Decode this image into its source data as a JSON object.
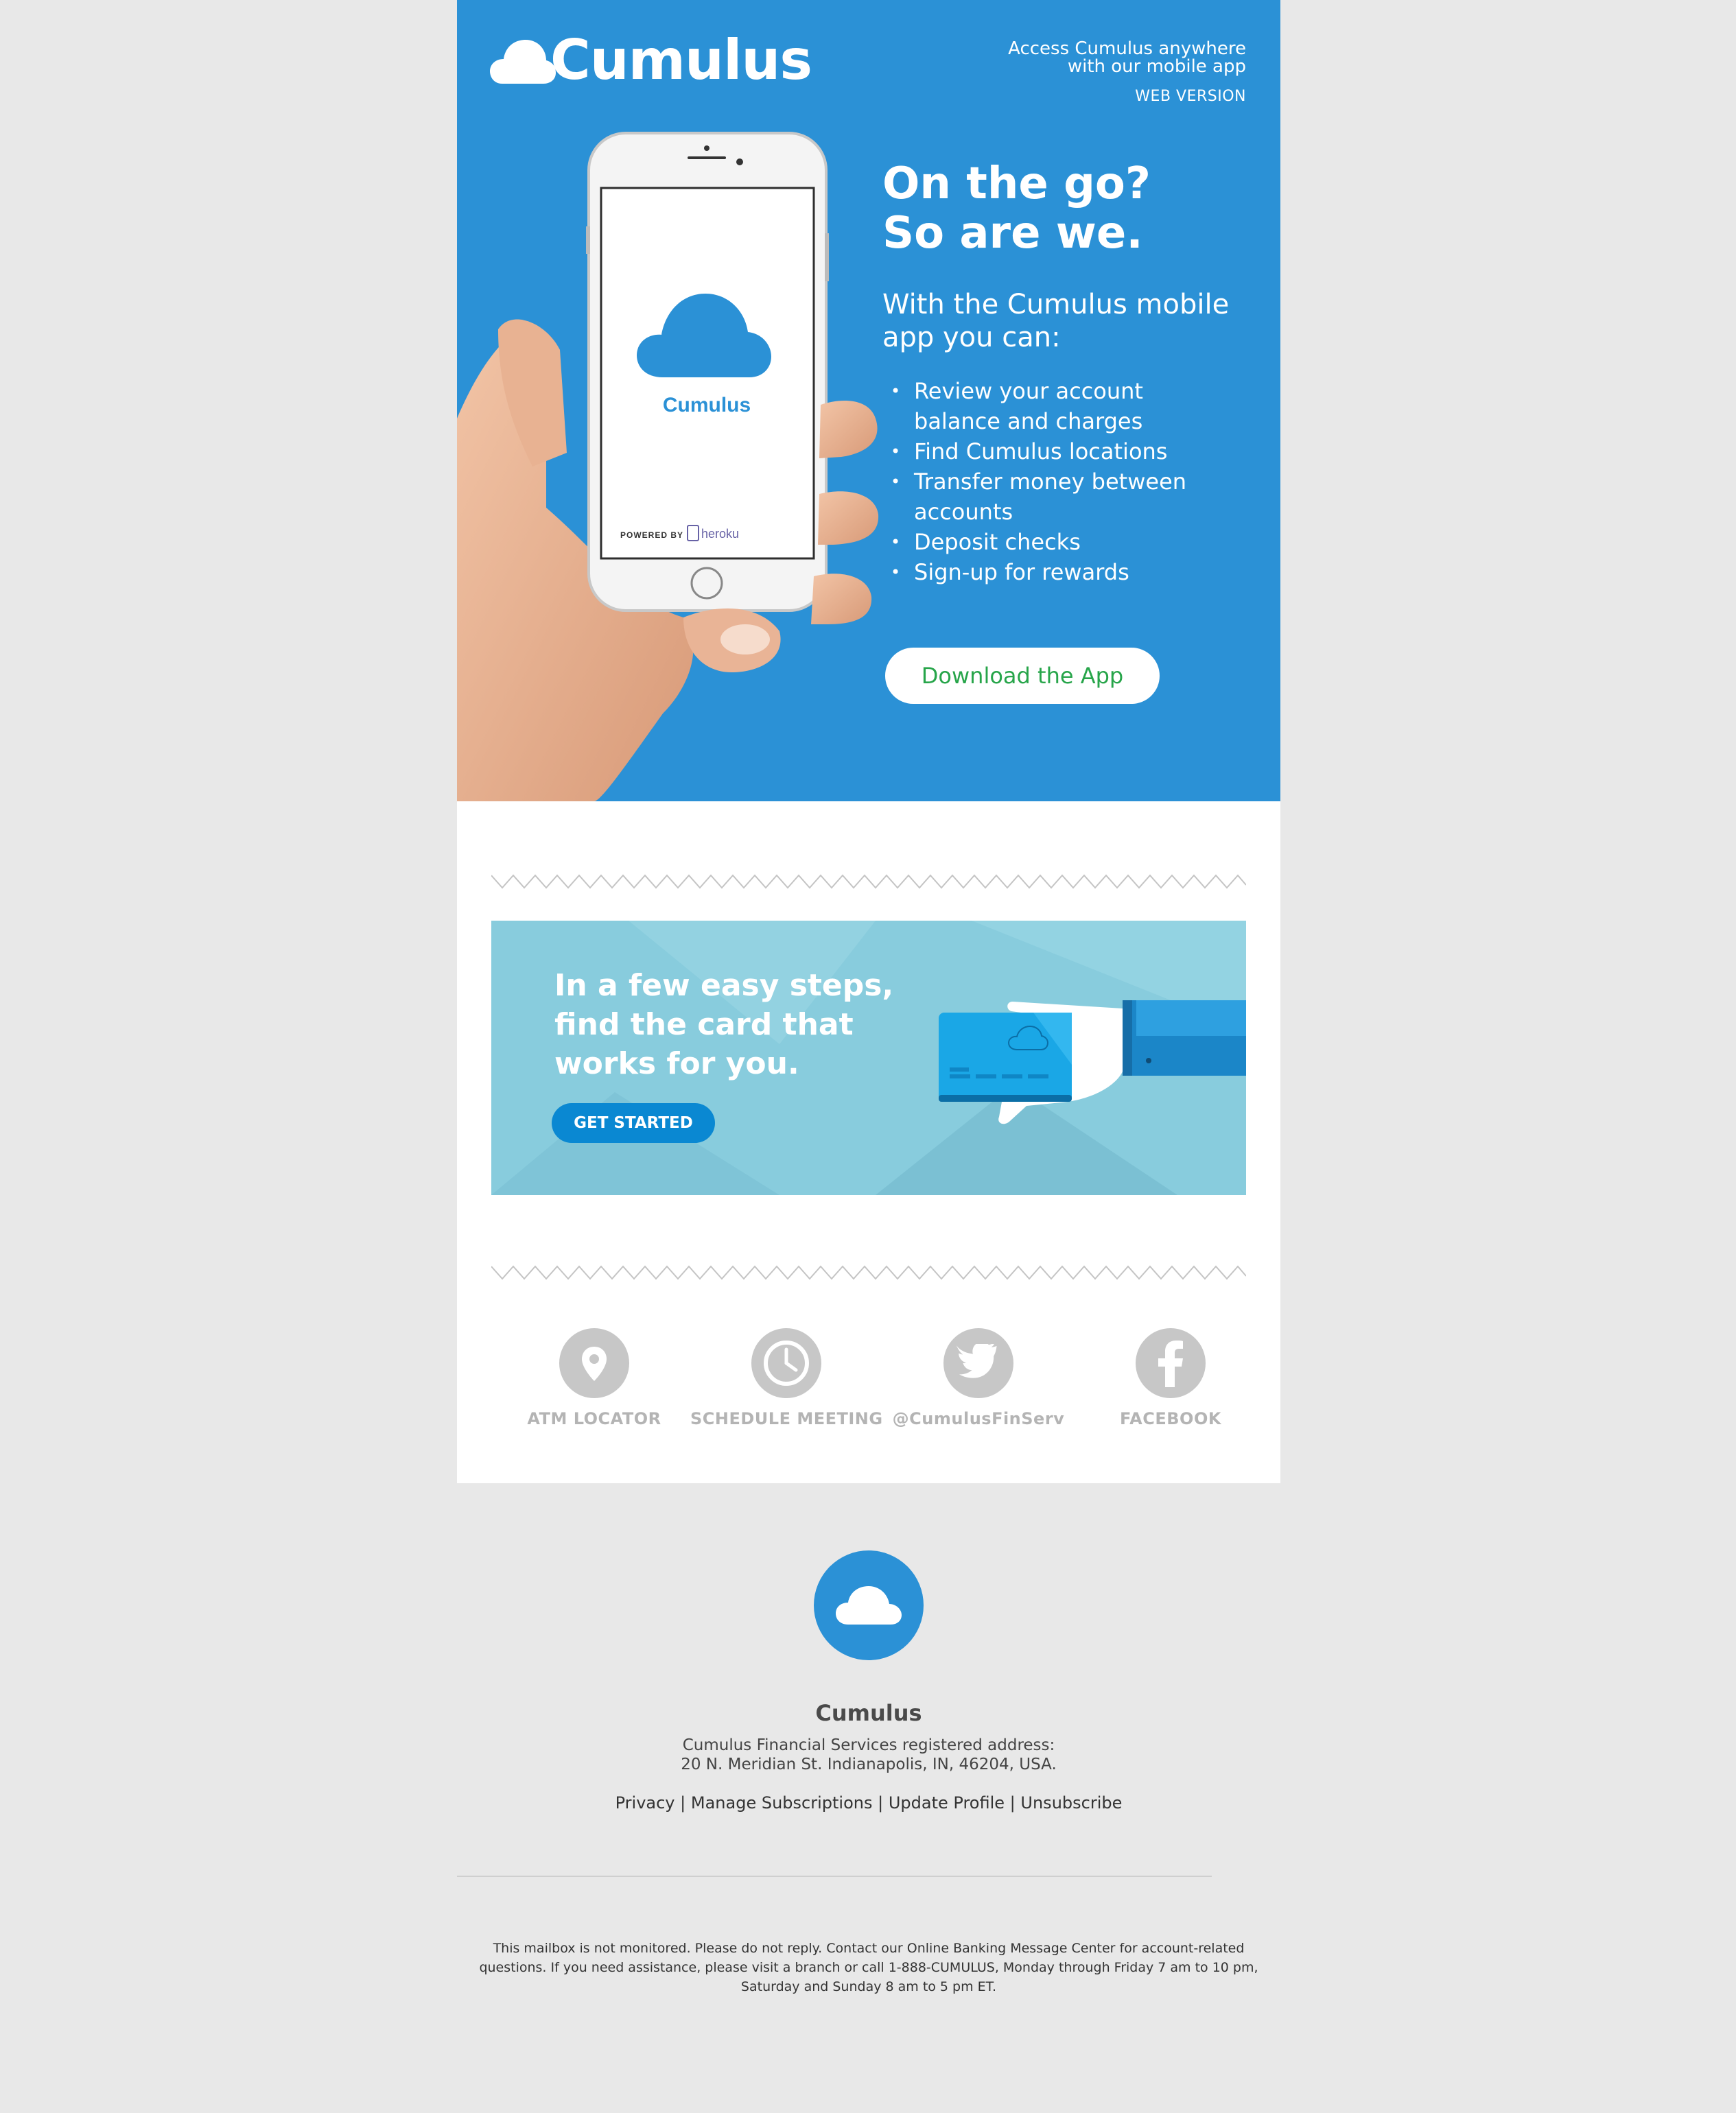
{
  "brand": {
    "name": "Cumulus",
    "primary_color": "#2b91d6",
    "accent_green": "#27a54a"
  },
  "header": {
    "logo_text": "Cumulus",
    "promo_line1": "Access Cumulus anywhere",
    "promo_line2": "with our mobile app",
    "web_version_link": "WEB VERSION"
  },
  "hero": {
    "headline_line1": "On the go?",
    "headline_line2": "So are we.",
    "subhead": "With the Cumulus mobile app you can:",
    "features": [
      "Review your account balance and charges",
      "Find Cumulus locations",
      "Transfer money between accounts",
      "Deposit checks",
      "Sign-up for rewards"
    ],
    "cta_label": "Download the App",
    "phone_app_name": "Cumulus",
    "phone_powered_by": "POWERED BY",
    "phone_heroku": "heroku"
  },
  "banner": {
    "line1": "In a few easy steps,",
    "line2": "find the card that",
    "line3": "works for you.",
    "cta_label": "GET STARTED"
  },
  "quick_links": [
    {
      "label": "ATM LOCATOR",
      "icon": "map-pin-icon"
    },
    {
      "label": "SCHEDULE MEETING",
      "icon": "clock-icon"
    },
    {
      "label": "@CumulusFinServ",
      "icon": "twitter-icon"
    },
    {
      "label": "FACEBOOK",
      "icon": "facebook-icon"
    }
  ],
  "footer": {
    "name": "Cumulus",
    "address_line1": "Cumulus Financial Services registered address:",
    "address_line2": "20 N. Meridian St. Indianapolis, IN, 46204, USA.",
    "links": [
      "Privacy",
      "Manage Subscriptions",
      "Update Profile",
      "Unsubscribe"
    ],
    "separator": "|",
    "disclaimer_line1": "This mailbox is not monitored. Please do not reply. Contact our Online Banking Message Center for account-related",
    "disclaimer_line2": "questions. If you need assistance, please visit a branch or call 1-888-CUMULUS, Monday through Friday 7 am to 10 pm,",
    "disclaimer_line3": "Saturday and Sunday 8 am to 5 pm ET."
  }
}
